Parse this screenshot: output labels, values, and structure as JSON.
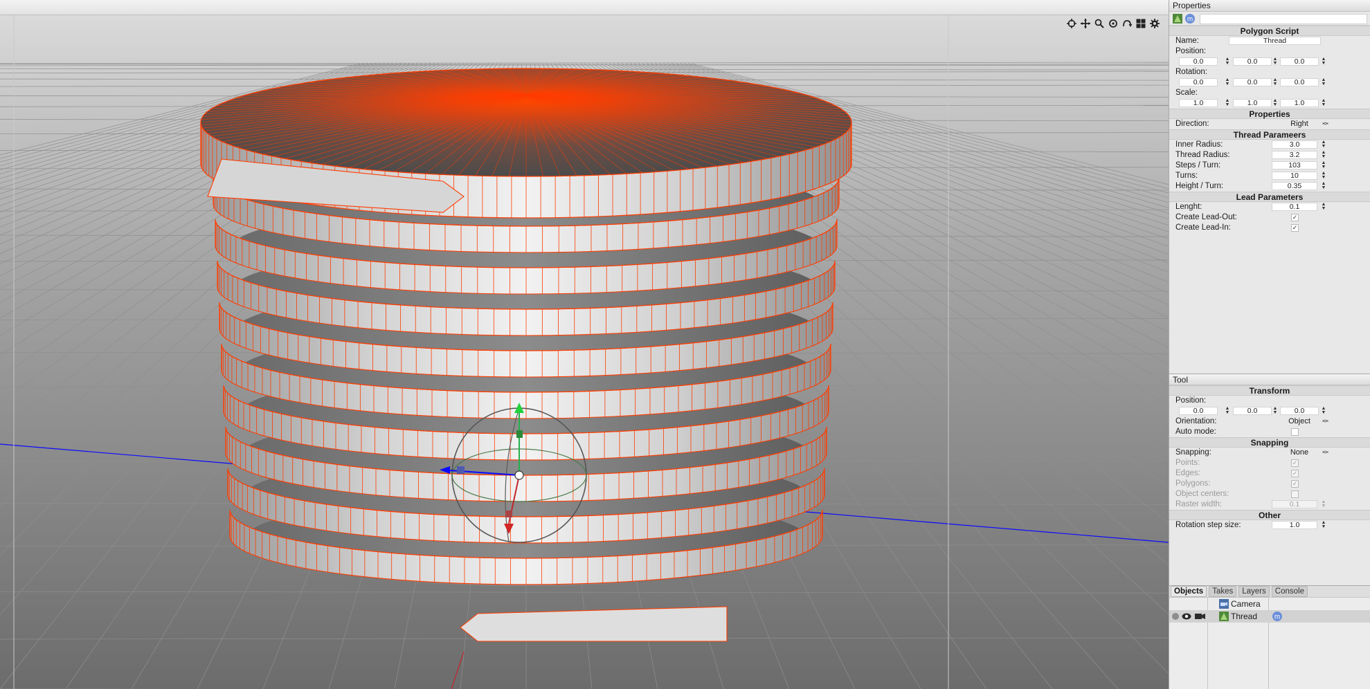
{
  "properties_panel": {
    "title": "Properties",
    "object_type": "Polygon Script",
    "name_label": "Name:",
    "name_value": "Thread",
    "position_label": "Position:",
    "position": [
      "0.0",
      "0.0",
      "0.0"
    ],
    "rotation_label": "Rotation:",
    "rotation": [
      "0.0",
      "0.0",
      "0.0"
    ],
    "scale_label": "Scale:",
    "scale": [
      "1.0",
      "1.0",
      "1.0"
    ],
    "properties_header": "Properties",
    "direction_label": "Direction:",
    "direction_value": "Right",
    "thread_header": "Thread Parameers",
    "inner_radius_label": "Inner Radius:",
    "inner_radius": "3.0",
    "thread_radius_label": "Thread Radius:",
    "thread_radius": "3.2",
    "steps_turn_label": "Steps / Turn:",
    "steps_turn": "103",
    "turns_label": "Turns:",
    "turns": "10",
    "height_turn_label": "Height / Turn:",
    "height_turn": "0.35",
    "lead_header": "Lead Parameters",
    "length_label": "Lenght:",
    "length": "0.1",
    "lead_out_label": "Create Lead-Out:",
    "lead_out_checked": true,
    "lead_in_label": "Create Lead-In:",
    "lead_in_checked": true
  },
  "tool_panel": {
    "title": "Tool",
    "transform_header": "Transform",
    "position_label": "Position:",
    "position": [
      "0.0",
      "0.0",
      "0.0"
    ],
    "orientation_label": "Orientation:",
    "orientation_value": "Object",
    "auto_mode_label": "Auto mode:",
    "auto_mode_checked": false,
    "snapping_header": "Snapping",
    "snapping_label": "Snapping:",
    "snapping_value": "None",
    "points_label": "Points:",
    "edges_label": "Edges:",
    "polygons_label": "Polygons:",
    "object_centers_label": "Object centers:",
    "raster_width_label": "Raster width:",
    "raster_width": "0.1",
    "other_header": "Other",
    "rotation_step_label": "Rotation step size:",
    "rotation_step": "1.0"
  },
  "objects_panel": {
    "tabs": [
      "Objects",
      "Takes",
      "Layers",
      "Console"
    ],
    "active_tab": "Objects",
    "items": [
      {
        "name": "Camera",
        "icon": "camera-icon"
      },
      {
        "name": "Thread",
        "icon": "polygon-script-icon",
        "selected": true
      }
    ]
  },
  "viewport": {
    "tool_icons": [
      "frame-all-icon",
      "move-view-icon",
      "zoom-icon",
      "rotate-view-icon",
      "undo-view-icon",
      "layout-icon",
      "settings-icon"
    ],
    "selection_color": "#ff3c00",
    "axis_colors": {
      "x": "#c1272d",
      "y": "#22b14c",
      "z": "#0a0aff"
    }
  }
}
